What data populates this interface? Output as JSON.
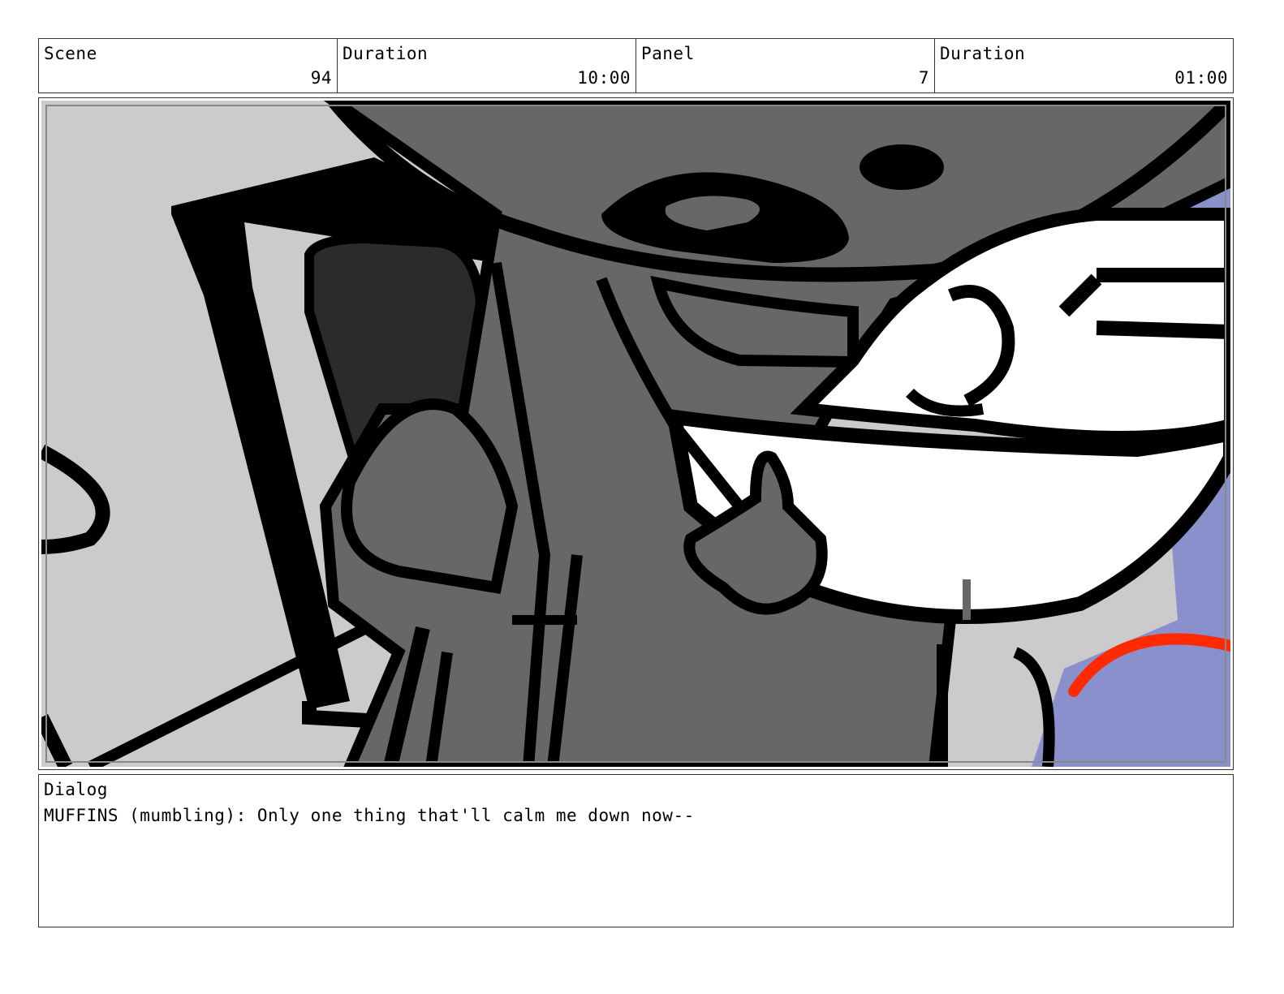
{
  "header": {
    "scene_label": "Scene",
    "scene_value": "94",
    "scene_duration_label": "Duration",
    "scene_duration_value": "10:00",
    "panel_label": "Panel",
    "panel_value": "7",
    "panel_duration_label": "Duration",
    "panel_duration_value": "01:00"
  },
  "dialog": {
    "label": "Dialog",
    "text": "MUFFINS (mumbling): Only one thing that'll calm me down now--"
  },
  "colors": {
    "background_gray": "#cbcbcb",
    "body_gray": "#676767",
    "dark_gray": "#2b2b2b",
    "sky_blue": "#8a90cc",
    "accent_red": "#ff2a00",
    "ink": "#000000"
  },
  "artwork": {
    "subject": "storyboard-panel-drawing"
  }
}
